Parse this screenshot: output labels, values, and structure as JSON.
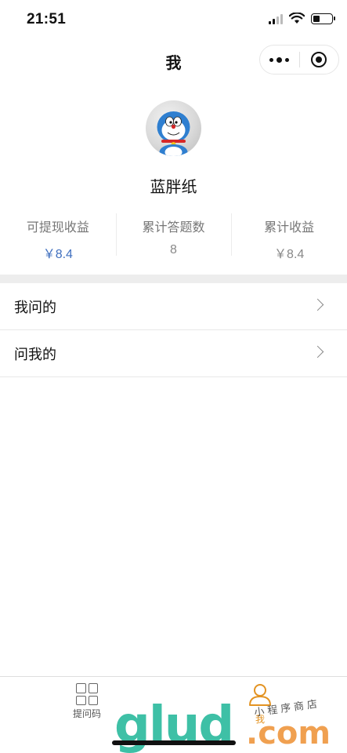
{
  "status_bar": {
    "time": "21:51",
    "icons": [
      "signal-icon",
      "wifi-icon",
      "battery-icon"
    ],
    "battery_level": 0.35
  },
  "nav": {
    "title": "我",
    "menu_icon": "more-dots-icon",
    "close_icon": "target-close-icon"
  },
  "profile": {
    "avatar_icon": "doraemon-avatar",
    "name": "蓝胖纸"
  },
  "stats": [
    {
      "label": "可提现收益",
      "value": "￥8.4"
    },
    {
      "label": "累计答题数",
      "value": "8"
    },
    {
      "label": "累计收益",
      "value": "￥8.4"
    }
  ],
  "menu": [
    {
      "label": "我问的"
    },
    {
      "label": "问我的"
    }
  ],
  "tab_bar": {
    "tabs": [
      {
        "label": "提问码",
        "icon": "grid-icon",
        "active": false
      },
      {
        "label": "我",
        "icon": "person-icon",
        "active": true
      }
    ]
  },
  "watermark": {
    "main": "glud",
    "com": ".com",
    "sub": "小程序商店"
  },
  "colors": {
    "accent": "#3f6fbf",
    "tab_active": "#e39322",
    "section_gap": "#ededed"
  }
}
